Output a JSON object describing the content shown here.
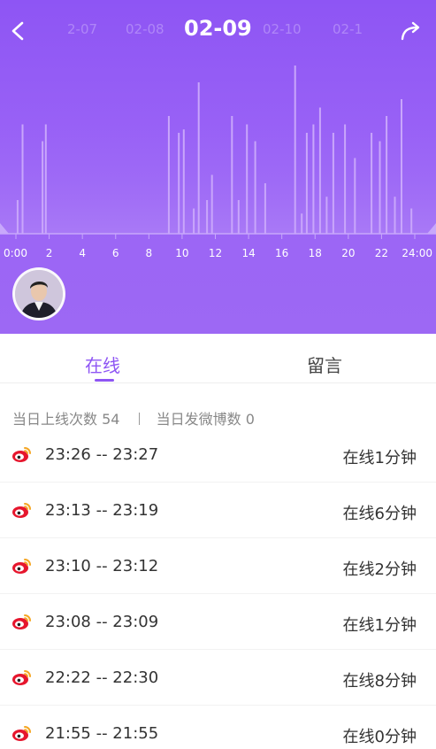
{
  "header": {
    "dates": [
      "2-07",
      "02-08",
      "02-09",
      "02-10",
      "02-1"
    ],
    "active_date": "02-09"
  },
  "chart_data": {
    "type": "bar",
    "x_ticks": [
      "0:00",
      "2",
      "4",
      "6",
      "8",
      "10",
      "12",
      "14",
      "16",
      "18",
      "20",
      "22",
      "24:00"
    ],
    "xlim": [
      0,
      24
    ],
    "ylim": [
      0,
      100
    ],
    "grid": false,
    "legend": "none",
    "bar_color": "#c9a6fb",
    "x": [
      0.1,
      0.4,
      1.6,
      1.8,
      9.2,
      9.8,
      10.1,
      10.7,
      11.0,
      11.5,
      11.8,
      13.0,
      13.4,
      13.9,
      14.4,
      15.0,
      16.8,
      17.2,
      17.5,
      17.9,
      18.3,
      18.7,
      19.1,
      19.8,
      20.4,
      21.4,
      21.9,
      22.3,
      22.8,
      23.2,
      23.8
    ],
    "values": [
      20,
      65,
      55,
      65,
      70,
      60,
      62,
      15,
      90,
      20,
      35,
      70,
      20,
      65,
      55,
      30,
      100,
      12,
      60,
      65,
      75,
      22,
      60,
      65,
      45,
      60,
      55,
      70,
      22,
      80,
      15
    ]
  },
  "tabs": {
    "online": "在线",
    "messages": "留言"
  },
  "stats": {
    "logins_label": "当日上线次数",
    "logins_value": "54",
    "posts_label": "当日发微博数",
    "posts_value": "0"
  },
  "sessions": [
    {
      "range": "23:26 -- 23:27",
      "duration": "在线1分钟"
    },
    {
      "range": "23:13 -- 23:19",
      "duration": "在线6分钟"
    },
    {
      "range": "23:10 -- 23:12",
      "duration": "在线2分钟"
    },
    {
      "range": "23:08 -- 23:09",
      "duration": "在线1分钟"
    },
    {
      "range": "22:22 -- 22:30",
      "duration": "在线8分钟"
    },
    {
      "range": "21:55 -- 21:55",
      "duration": "在线0分钟"
    }
  ],
  "icons": {
    "back": "chevron-left-icon",
    "share": "share-arrow-icon",
    "session": "weibo-icon"
  },
  "colors": {
    "accent": "#8e55f4",
    "weibo_red": "#e6162d",
    "weibo_yellow": "#f5a623"
  }
}
